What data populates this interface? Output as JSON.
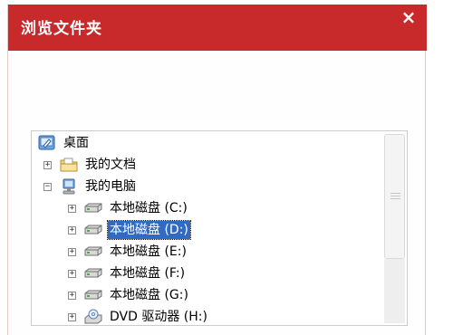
{
  "dialog": {
    "title": "浏览文件夹",
    "close_symbol": "×"
  },
  "tree": {
    "items": [
      {
        "label": "桌面",
        "icon": "desktop-icon",
        "expander": ""
      },
      {
        "label": "我的文档",
        "icon": "my-documents-folder-icon",
        "expander": "+"
      },
      {
        "label": "我的电脑",
        "icon": "my-computer-icon",
        "expander": "−"
      },
      {
        "label": "本地磁盘 (C:)",
        "icon": "hard-drive-icon",
        "expander": "+"
      },
      {
        "label": "本地磁盘 (D:)",
        "icon": "hard-drive-icon",
        "expander": "+",
        "selected": true
      },
      {
        "label": "本地磁盘 (E:)",
        "icon": "hard-drive-icon",
        "expander": "+"
      },
      {
        "label": "本地磁盘 (F:)",
        "icon": "hard-drive-icon",
        "expander": "+"
      },
      {
        "label": "本地磁盘 (G:)",
        "icon": "hard-drive-icon",
        "expander": "+"
      },
      {
        "label": "DVD 驱动器 (H:)",
        "icon": "dvd-drive-icon",
        "expander": "+"
      }
    ]
  },
  "colors": {
    "titlebar": "#c8292a",
    "selection": "#316ac5"
  }
}
